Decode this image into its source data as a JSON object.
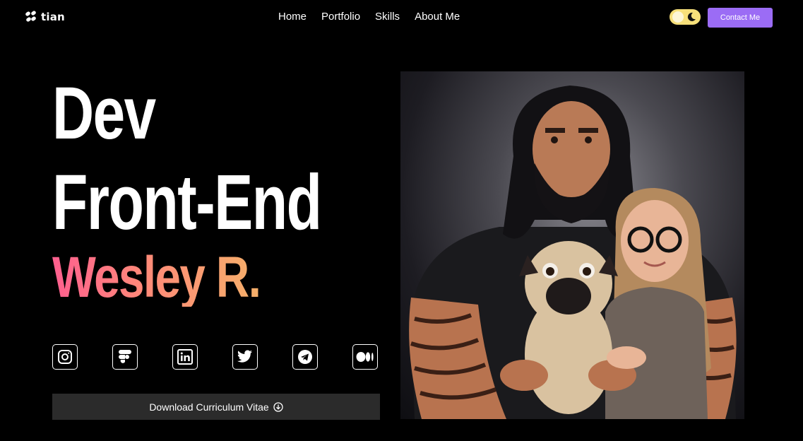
{
  "nav": {
    "logo_text": "tian",
    "links": [
      "Home",
      "Portfolio",
      "Skills",
      "About Me"
    ],
    "contact_label": "Contact Me"
  },
  "hero": {
    "line1": "Dev",
    "line2": "Front-End",
    "name": "Wesley R."
  },
  "socials": [
    "instagram-icon",
    "figma-icon",
    "linkedin-icon",
    "twitter-icon",
    "telegram-icon",
    "medium-icon"
  ],
  "download_label": "Download Curriculum Vitae",
  "colors": {
    "accent": "#9b6cf5",
    "toggle": "#f7e07a",
    "name_gradient_start": "#ff5f8f",
    "name_gradient_end": "#f5b06a",
    "download_bg": "#2b2b2b"
  }
}
